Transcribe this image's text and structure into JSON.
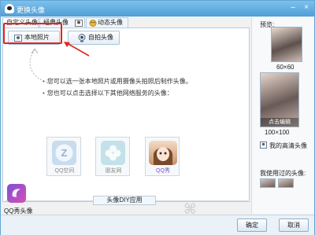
{
  "window": {
    "title": "更换头像"
  },
  "tabs": [
    {
      "label": "自定义头像"
    },
    {
      "label": "经典头像"
    },
    {
      "label": "动态头像"
    }
  ],
  "buttons": {
    "local_photo": "本地照片",
    "self_photo": "自拍头像"
  },
  "hints": [
    "您可以选一张本地照片或用摄像头拍照后制作头像。",
    "您也可以点击选择以下其他网络服务的头像："
  ],
  "services": [
    {
      "label": "QQ空间",
      "icon": "qzone-icon",
      "color": "#6fa9d4"
    },
    {
      "label": "朋友网",
      "icon": "pengyou-icon",
      "color": "#63b7c8"
    },
    {
      "label": "QQ秀",
      "icon": "qqshow-icon",
      "color": "#c9a37b"
    }
  ],
  "diy_tab": "头像DIY应用",
  "qqshow_avatar": {
    "label": "QQ秀头像"
  },
  "preview": {
    "title": "预览:",
    "small_size": "60×60",
    "large_overlay": "点击编辑",
    "large_size": "100×100",
    "hd_label": "我的高清头像",
    "used_label": "我使用过的头像:"
  },
  "footer": {
    "ok": "确定",
    "cancel": "取消"
  }
}
